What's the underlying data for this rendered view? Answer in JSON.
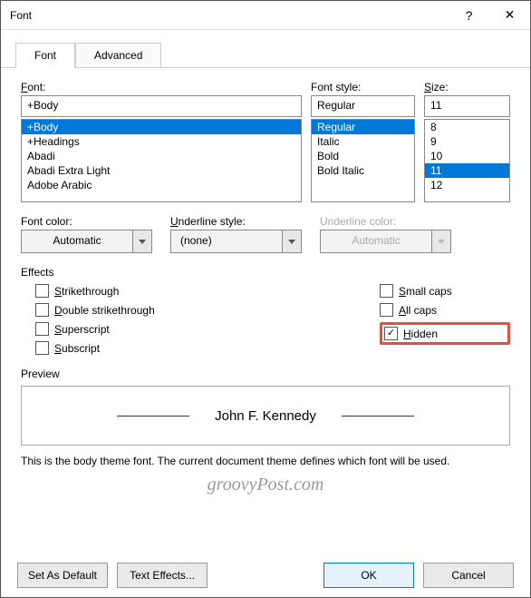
{
  "title": "Font",
  "tabs": {
    "font": "Font",
    "advanced": "Advanced"
  },
  "labels": {
    "font": "Font:",
    "fontStyle": "Font style:",
    "size": "Size:",
    "fontColor": "Font color:",
    "underlineStyle": "Underline style:",
    "underlineColor": "Underline color:"
  },
  "font": {
    "value": "+Body",
    "options": [
      "+Body",
      "+Headings",
      "Abadi",
      "Abadi Extra Light",
      "Adobe Arabic"
    ],
    "selected": "+Body"
  },
  "fontStyle": {
    "value": "Regular",
    "options": [
      "Regular",
      "Italic",
      "Bold",
      "Bold Italic"
    ],
    "selected": "Regular"
  },
  "size": {
    "value": "11",
    "options": [
      "8",
      "9",
      "10",
      "11",
      "12"
    ],
    "selected": "11"
  },
  "fontColor": "Automatic",
  "underlineStyle": "(none)",
  "underlineColor": "Automatic",
  "effects": {
    "title": "Effects",
    "left": [
      {
        "label": "Strikethrough",
        "checked": false
      },
      {
        "label": "Double strikethrough",
        "checked": false
      },
      {
        "label": "Superscript",
        "checked": false
      },
      {
        "label": "Subscript",
        "checked": false
      }
    ],
    "right": [
      {
        "label": "Small caps",
        "checked": false
      },
      {
        "label": "All caps",
        "checked": false
      },
      {
        "label": "Hidden",
        "checked": true,
        "highlight": true
      }
    ]
  },
  "preview": {
    "title": "Preview",
    "sample": "John F. Kennedy",
    "note": "This is the body theme font. The current document theme defines which font will be used."
  },
  "watermark": "groovyPost.com",
  "buttons": {
    "setDefault": "Set As Default",
    "textEffects": "Text Effects...",
    "ok": "OK",
    "cancel": "Cancel"
  }
}
